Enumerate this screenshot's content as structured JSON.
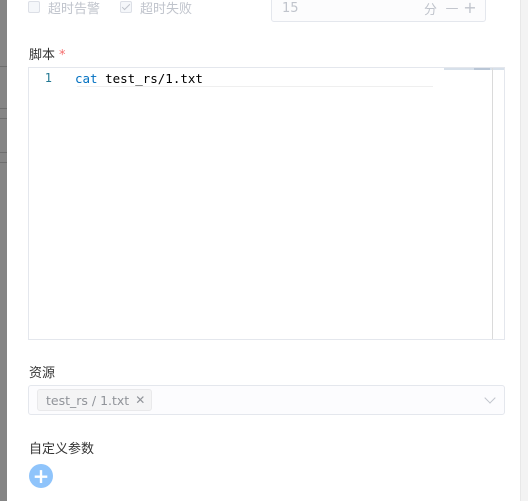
{
  "timeout": {
    "alarm_label": "超时告警",
    "alarm_checked": false,
    "fail_label": "超时失败",
    "fail_checked": true,
    "value": "15",
    "unit": "分",
    "minus": "—",
    "plus": "+"
  },
  "script": {
    "label": "脚本",
    "required_mark": "*",
    "lines": [
      {
        "number": "1",
        "keyword": "cat",
        "rest": " test_rs/1.txt"
      }
    ]
  },
  "resource": {
    "label": "资源",
    "selected": [
      {
        "label": "test_rs / 1.txt"
      }
    ],
    "icons": {
      "remove": "close-icon",
      "dropdown": "chevron-down-icon"
    }
  },
  "custom_params": {
    "label": "自定义参数",
    "add_icon": "plus-icon"
  },
  "colors": {
    "accent_light": "#8fc4fb",
    "required": "#f56c6c",
    "line_number": "#237893",
    "keyword": "#0070c1"
  }
}
